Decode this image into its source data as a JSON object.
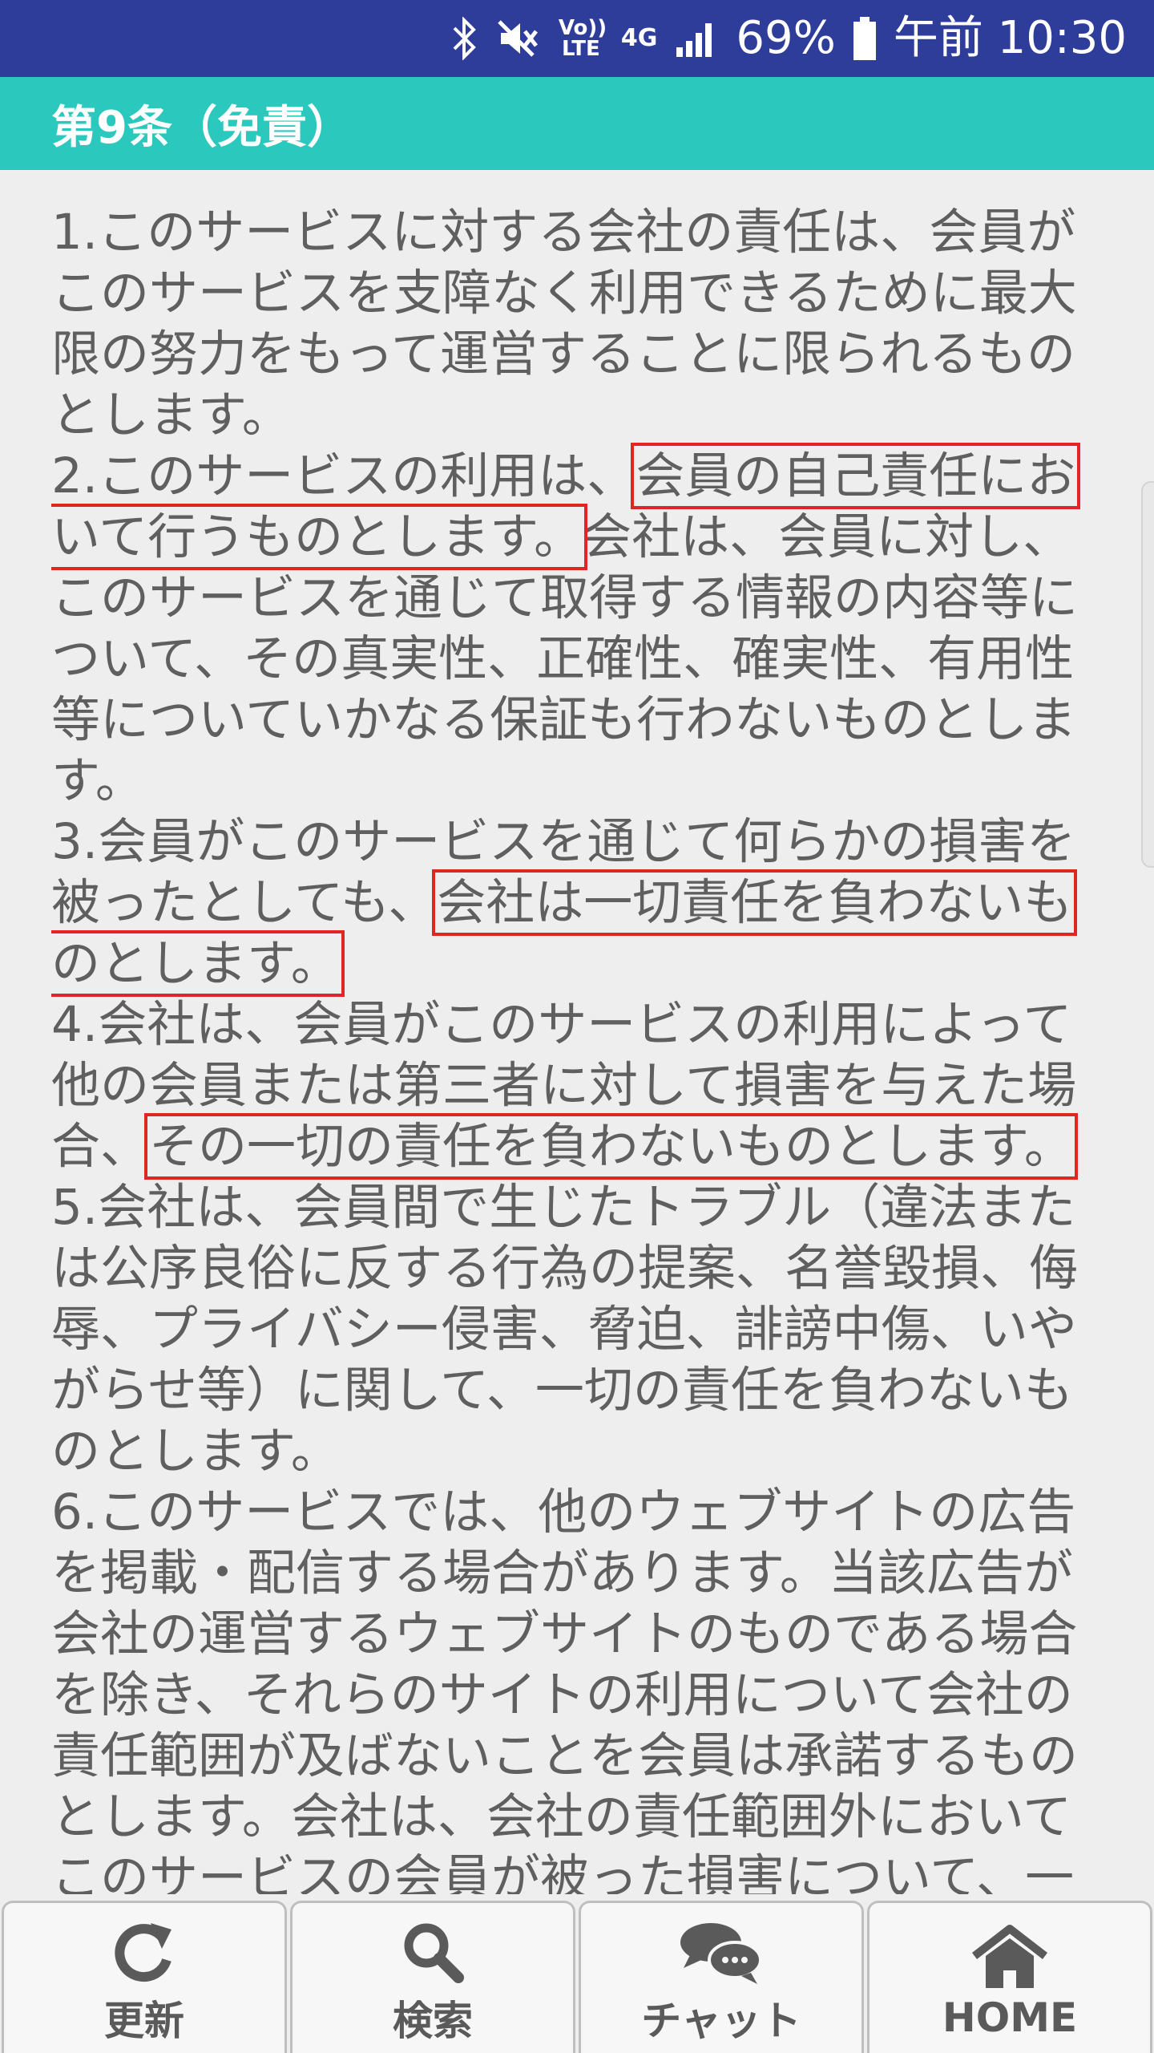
{
  "status_bar": {
    "volte": "Vo)) LTE",
    "network": "4G",
    "battery": "69%",
    "time": "午前 10:30"
  },
  "header": {
    "title": "第9条（免責）"
  },
  "content": {
    "p1": "1.このサービスに対する会社の責任は、会員がこのサービスを支障なく利用できるために最大限の努力をもって運営することに限られるものとします。",
    "p2_a": "2.このサービスの利用は、",
    "p2_hl": "会員の自己責任において行うものとします。",
    "p2_b": "会社は、会員に対し、このサービスを通じて取得する情報の内容等について、その真実性、正確性、確実性、有用性等についていかなる保証も行わないものとします。",
    "p3_a": "3.会員がこのサービスを通じて何らかの損害を被ったとしても、",
    "p3_hl": "会社は一切責任を負わないものとします。",
    "p4_a": "4.会社は、会員がこのサービスの利用によって他の会員または第三者に対して損害を与えた場合、",
    "p4_hl": "その一切の責任を負わないものとします。",
    "p5": "5.会社は、会員間で生じたトラブル（違法または公序良俗に反する行為の提案、名誉毀損、侮辱、プライバシー侵害、脅迫、誹謗中傷、いやがらせ等）に関して、一切の責任を負わないものとします。",
    "p6": "6.このサービスでは、他のウェブサイトの広告を掲載・配信する場合があります。当該広告が会社の運営するウェブサイトのものである場合を除き、それらのサイトの利用について会社の責任範囲が及ばないことを会員は承諾するものとします。会社は、会社の責任範囲外においてこのサービスの会員が被った損害について、一"
  },
  "bottom_nav": {
    "refresh": "更新",
    "search": "検索",
    "chat": "チャット",
    "home": "HOME"
  },
  "colors": {
    "status_bar": "#2f3d9a",
    "header": "#2bc8bd",
    "highlight_border": "#e02525",
    "body_text": "#5f5f5f"
  },
  "icons": [
    "bluetooth-icon",
    "mute-icon",
    "signal-icon",
    "battery-icon",
    "refresh-icon",
    "search-icon",
    "chat-icon",
    "home-icon"
  ]
}
